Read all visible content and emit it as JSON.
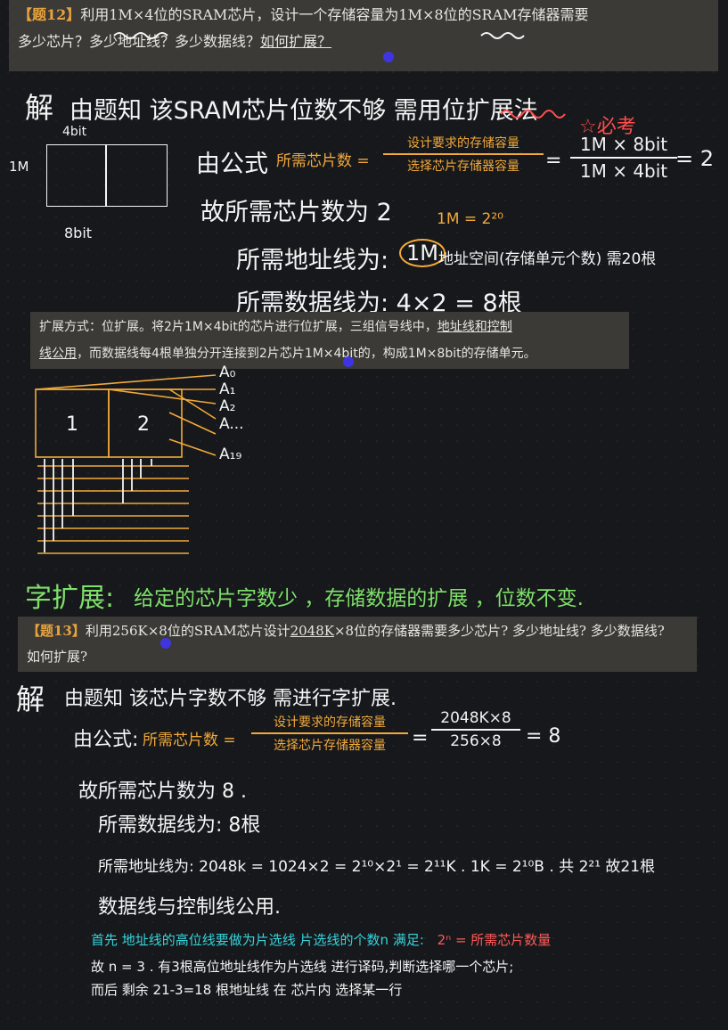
{
  "q12": {
    "tag": "【题12】",
    "line1_pre": "利用",
    "line1_chip": "1M×4位",
    "line1_mid": "的SRAM芯片，设计一个存储容量为",
    "line1_target": "1M×8位",
    "line1_post": "的SRAM存储器需要",
    "line2": "多少芯片？多少地址线？多少数据线？",
    "line2_link": "如何扩展？"
  },
  "sol12": {
    "jie": "解",
    "intro": "由题知 该SRAM芯片位数不够 需用位扩展法",
    "must_memo": "必考",
    "chip_top_label": "4bit",
    "chip_left_label": "1M",
    "chip_bottom_label": "8bit",
    "formula_lead": "由公式",
    "formula_name": "所需芯片数 =",
    "formula_num": "设计要求的存储容量",
    "formula_den": "选择芯片存储器容量",
    "eq1": "=",
    "calc_num": "1M × 8bit",
    "calc_den": "1M × 4bit",
    "calc_result": "= 2",
    "chips_line": "故所需芯片数为 2",
    "note_power": "1M = 2²⁰",
    "addr_line_pre": "所需地址线为:",
    "addr_circled": "1M",
    "addr_line_post": "地址空间(存储单元个数) 需20根",
    "data_line": "所需数据线为: 4×2 = 8根"
  },
  "method12": {
    "line1_pre": "扩展方式：位扩展。将2片1M×4bit的芯片进行位扩展，三组信号线中，",
    "line1_u": "地址线和控制",
    "line2_u": "线公用",
    "line2_post": "，而数据线每4根单独分开连接到2片芯片1M×4bit的，构成1M×8bit的存储单元。"
  },
  "diagram12": {
    "chip1": "1",
    "chip2": "2",
    "addr_labels": [
      "A₀",
      "A₁",
      "A₂",
      "A...",
      "A₁₉"
    ]
  },
  "summary": {
    "title": "字扩展:",
    "text": "给定的芯片字数少 ，存储数据的扩展 ，位数不变."
  },
  "q13": {
    "tag": "【题13】",
    "line1_pre": "利用256K×8位的SRAM芯片设计",
    "line1_u": "2048K",
    "line1_post": "×8位的存储器需要多少芯片? 多少地址线? 多少数据线?",
    "line2": "如何扩展?"
  },
  "sol13": {
    "jie": "解",
    "intro": "由题知 该芯片字数不够 需进行字扩展.",
    "formula_lead": "由公式:",
    "formula_name": "所需芯片数 =",
    "formula_num": "设计要求的存储容量",
    "formula_den": "选择芯片存储器容量",
    "eq1": "=",
    "calc_num": "2048K×8",
    "calc_den": "256×8",
    "calc_result": "= 8",
    "chips_line": "故所需芯片数为 8 .",
    "data_line": "所需数据线为: 8根",
    "addr_line": "所需地址线为: 2048k = 1024×2 = 2¹⁰×2¹ = 2¹¹K .   1K = 2¹⁰B . 共 2²¹ 故21根",
    "shared_line": "数据线与控制线公用.",
    "note1_pre": "首先 地址线的高位线要做为片选线  片选线的个数n 满足:",
    "note1_red": "2ⁿ = 所需芯片数量",
    "note2": "故 n = 3 . 有3根高位地址线作为片选线 进行译码,判断选择哪一个芯片;",
    "note3": "而后 剩余 21-3=18 根地址线 在 芯片内 选择某一行"
  },
  "colors": {
    "orange": "#f2a93a",
    "green": "#7fe06a",
    "cyan": "#35d4dc",
    "red": "#ff5a5a",
    "paper": "#3b3a37"
  }
}
